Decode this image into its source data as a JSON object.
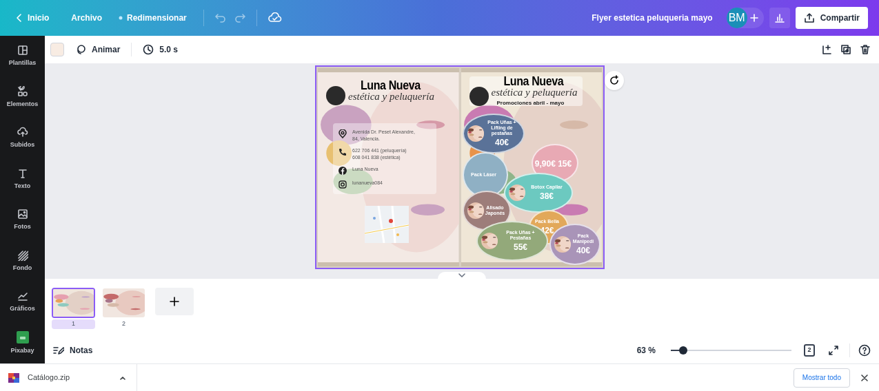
{
  "topbar": {
    "back": "Inicio",
    "menu": [
      "Archivo",
      "Redimensionar"
    ],
    "title": "Flyer estetica peluqueria mayo",
    "avatar": "BM",
    "share": "Compartir"
  },
  "sidebar": {
    "items": [
      {
        "label": "Plantillas"
      },
      {
        "label": "Elementos"
      },
      {
        "label": "Subidos"
      },
      {
        "label": "Texto"
      },
      {
        "label": "Fotos"
      },
      {
        "label": "Fondo"
      },
      {
        "label": "Gráficos"
      },
      {
        "label": "Pixabay"
      }
    ]
  },
  "toolbar": {
    "animate": "Animar",
    "duration": "5.0 s"
  },
  "flyer": {
    "pages": [
      {
        "kind": "contact",
        "brand": "Luna Nueva",
        "tagline": "estética y peluquería",
        "contacts": [
          {
            "kind": "address",
            "lines": [
              "Avenida Dr. Peset Alexandre,",
              "84, Valencia."
            ]
          },
          {
            "kind": "phone",
            "lines": [
              "622 706 441 (peluquería)",
              "608 041 838 (estética)"
            ]
          },
          {
            "kind": "facebook",
            "lines": [
              "Luna Nueva"
            ]
          },
          {
            "kind": "instagram",
            "lines": [
              "lunanueva084"
            ]
          }
        ]
      },
      {
        "kind": "promo",
        "brand": "Luna Nueva",
        "tagline": "estética y peluquería",
        "promo": "Promociones abril - mayo",
        "offers": [
          {
            "title": "Pack Uñas + Lifting de pestañas",
            "price": "40€",
            "color": "#5a7298"
          },
          {
            "kind": "plain",
            "price": "9,90€ 15€",
            "color": "#e8a9b4"
          },
          {
            "kind": "plain",
            "title": "Pack Láser",
            "color": "#8fb0c4"
          },
          {
            "title": "Botox Capilar",
            "price": "38€",
            "color": "#6cc9c0"
          },
          {
            "title": "Alisado Japonés",
            "color": "#9d7d7a"
          },
          {
            "kind": "plain",
            "title": "Pack Bella",
            "price": "42€",
            "color": "#e2a85a"
          },
          {
            "title": "Pack Uñas + Pestañas",
            "price": "55€",
            "color": "#93a97a"
          },
          {
            "title": "Pack Manipedi",
            "price": "40€",
            "color": "#a994b8"
          }
        ]
      }
    ]
  },
  "pages": [
    {
      "number": "1",
      "selected": true
    },
    {
      "number": "2",
      "selected": false
    }
  ],
  "footer": {
    "notes": "Notas",
    "zoom": "63 %",
    "level": 0.1,
    "page_count": "2"
  },
  "downloads": {
    "file": "Catálogo.zip",
    "show_all": "Mostrar todo"
  }
}
